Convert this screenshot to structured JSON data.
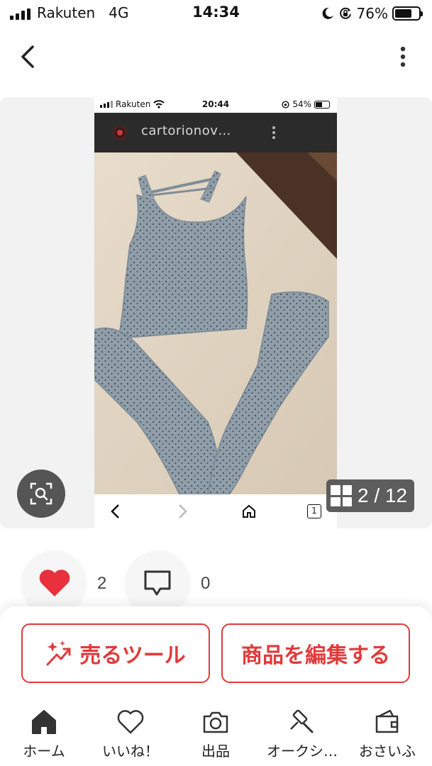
{
  "status_bar": {
    "carrier": "Rakuten",
    "network": "4G",
    "time": "14:34",
    "battery": "76%",
    "battery_level": 0.76
  },
  "listing_image": {
    "inner_status": {
      "carrier": "Rakuten",
      "time": "20:44",
      "battery": "54%",
      "battery_level": 0.54
    },
    "inner_account": "cartorionov…",
    "inner_page_badge": "1",
    "counter": "2 / 12"
  },
  "reactions": {
    "likes": "2",
    "comments": "0"
  },
  "actions": {
    "sell_tools": "売るツール",
    "edit_item": "商品を編集する"
  },
  "tabs": [
    {
      "label": "ホーム",
      "icon": "home-icon"
    },
    {
      "label": "いいね！",
      "icon": "heart-outline-icon"
    },
    {
      "label": "出品",
      "icon": "camera-icon"
    },
    {
      "label": "オークシ…",
      "icon": "auction-gavel-icon"
    },
    {
      "label": "おさいふ",
      "icon": "wallet-icon"
    }
  ],
  "colors": {
    "accent": "#e23a3a",
    "heart": "#e8313d",
    "active_tab": "#333333"
  }
}
